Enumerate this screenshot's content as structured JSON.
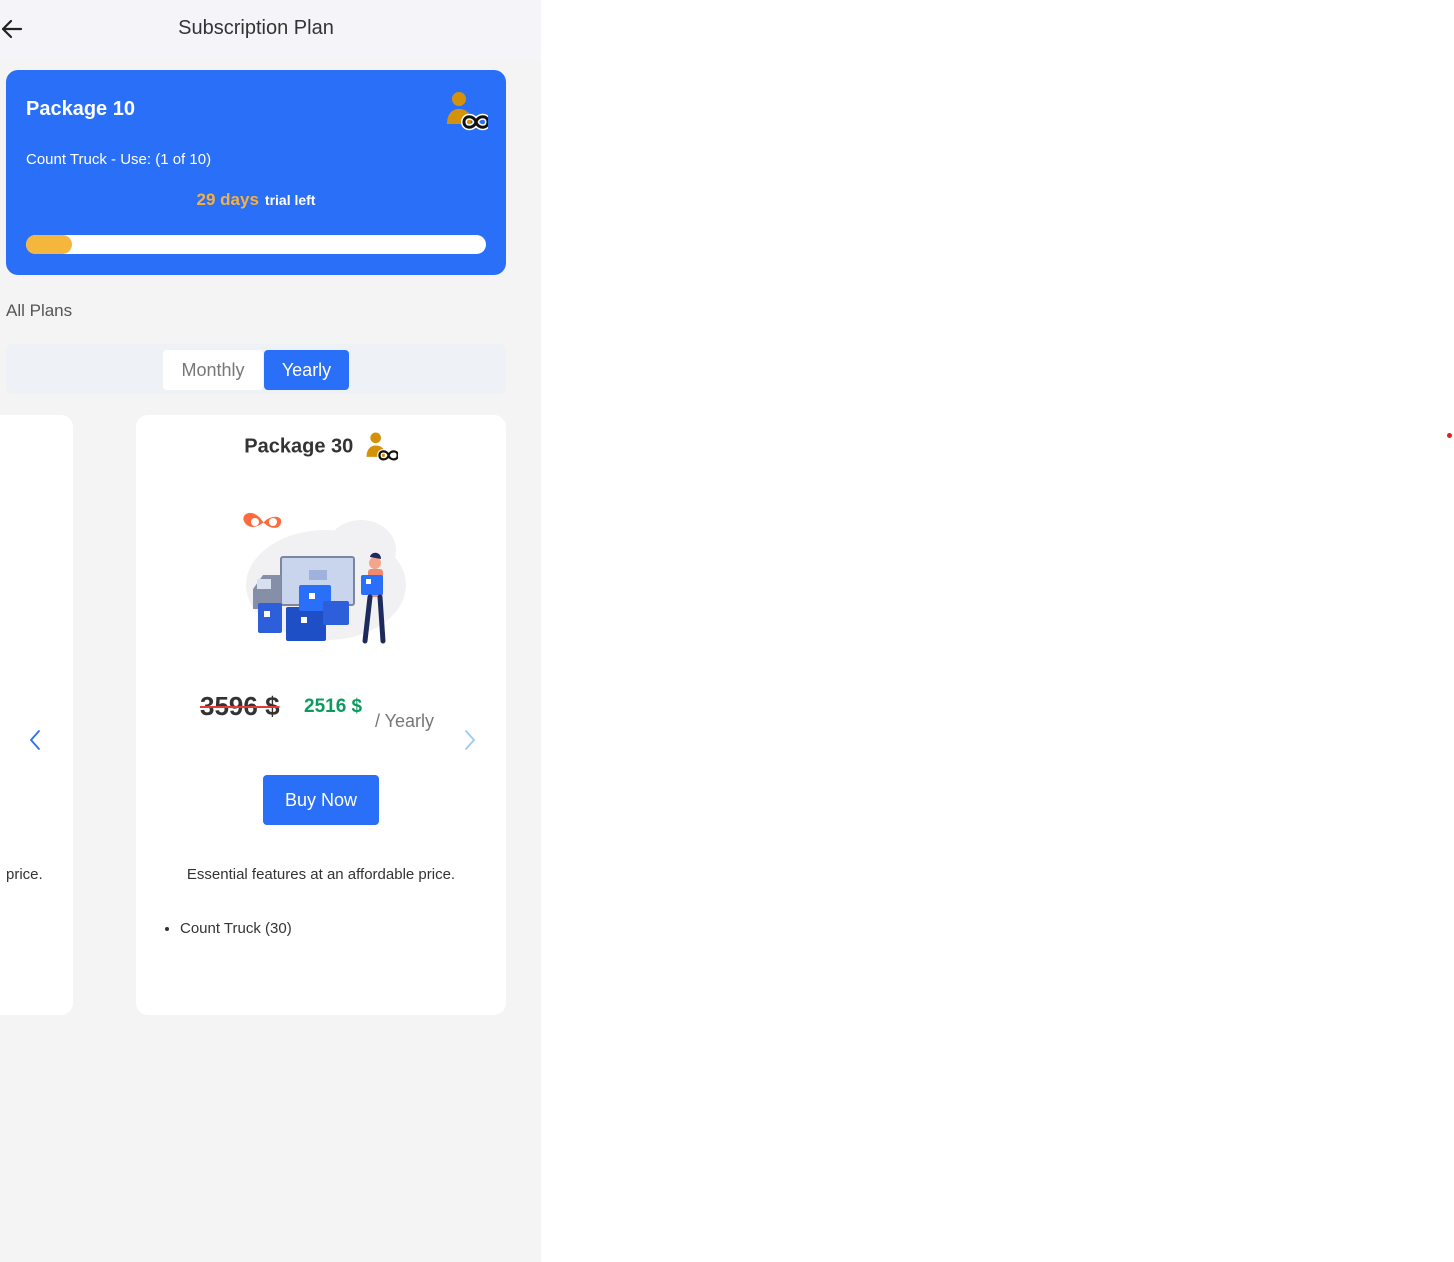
{
  "header": {
    "title": "Subscription Plan"
  },
  "current_plan": {
    "name": "Package 10",
    "usage_text": "Count Truck - Use: (1 of 10)",
    "trial_days": "29 days",
    "trial_suffix": "trial left",
    "usage_progress_fraction": 0.1,
    "icon": "user-infinity-icon"
  },
  "plans_section": {
    "label": "All Plans",
    "billing_toggle": {
      "options": [
        "Monthly",
        "Yearly"
      ],
      "selected": "Yearly"
    }
  },
  "carousel": {
    "previous_card_text_fragment": "price.",
    "current_card": {
      "name": "Package 30",
      "old_price": "3596 $",
      "new_price": "2516 $",
      "period": "/ Yearly",
      "buy_label": "Buy Now",
      "description": "Essential features at an affordable price.",
      "features": [
        "Count Truck (30)"
      ]
    }
  },
  "colors": {
    "accent": "#2a6ff7",
    "trial_days": "#f5b041",
    "discount_price": "#0d9a5f",
    "strike_line": "#e53935"
  }
}
